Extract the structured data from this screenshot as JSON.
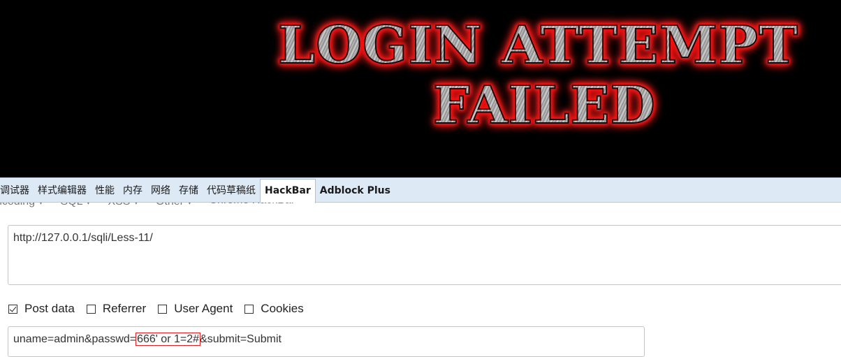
{
  "banner": {
    "line1": "LOGIN ATTEMPT",
    "line2": "FAILED",
    "glow_color": "#ff1a1a"
  },
  "devtools_tabs": [
    {
      "label": "调试器",
      "active": false
    },
    {
      "label": "样式编辑器",
      "active": false
    },
    {
      "label": "性能",
      "active": false
    },
    {
      "label": "内存",
      "active": false
    },
    {
      "label": "网络",
      "active": false
    },
    {
      "label": "存储",
      "active": false
    },
    {
      "label": "代码草稿纸",
      "active": false
    },
    {
      "label": "HackBar",
      "active": true
    },
    {
      "label": "Adblock Plus",
      "active": false
    }
  ],
  "hackbar": {
    "menu": [
      "ncoding ▾",
      "SQL ▾",
      "XSS ▾",
      "Other ▾",
      "Chrome HackBar"
    ],
    "url_value": "http://127.0.0.1/sqli/Less-11/",
    "options": [
      {
        "label": "Post data",
        "checked": true
      },
      {
        "label": "Referrer",
        "checked": false
      },
      {
        "label": "User Agent",
        "checked": false
      },
      {
        "label": "Cookies",
        "checked": false
      }
    ],
    "post_data": {
      "prefix": "uname=admin&passwd=",
      "highlighted": "666' or 1=2#",
      "suffix": "&submit=Submit"
    },
    "highlight_color": "#e02020"
  }
}
